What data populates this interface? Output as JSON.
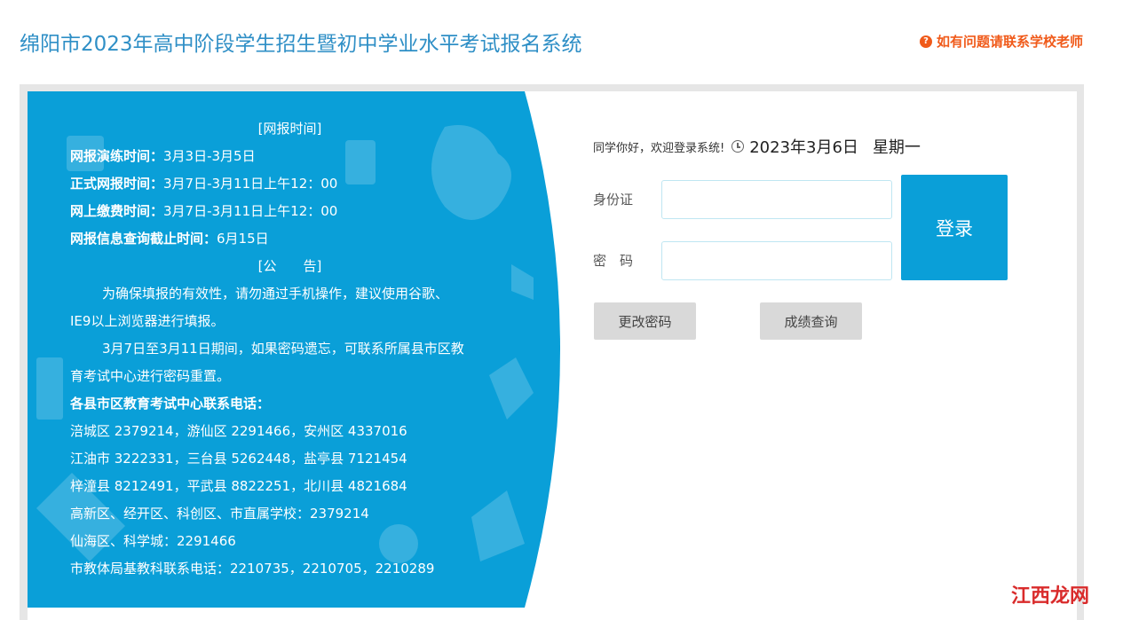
{
  "header": {
    "title": "绵阳市2023年高中阶段学生招生暨初中学业水平考试报名系统",
    "help_text": "如有问题请联系学校老师",
    "help_icon": "question-icon"
  },
  "notice": {
    "heading": "[网报时间]",
    "schedule": [
      {
        "label": "网报演练时间：",
        "value": "3月3日-3月5日"
      },
      {
        "label": "正式网报时间：",
        "value": "3月7日-3月11日上午12：00"
      },
      {
        "label": "网上缴费时间：",
        "value": "3月7日-3月11日上午12：00"
      },
      {
        "label": "网报信息查询截止时间：",
        "value": "6月15日"
      }
    ],
    "announcement_heading": "[公　　告]",
    "paragraph1_line1": "为确保填报的有效性，请勿通过手机操作，建议使用谷歌、",
    "paragraph1_line2": "IE9以上浏览器进行填报。",
    "paragraph2_line1": "3月7日至3月11日期间，如果密码遗忘，可联系所属县市区教",
    "paragraph2_line2": "育考试中心进行密码重置。",
    "phones_heading": "各县市区教育考试中心联系电话：",
    "phones": [
      "涪城区  2379214，游仙区  2291466，安州区  4337016",
      "江油市  3222331，三台县  5262448，盐亭县  7121454",
      "梓潼县  8212491，平武县  8822251，北川县  4821684",
      "高新区、经开区、科创区、市直属学校：2379214",
      "仙海区、科学城：2291466",
      "市教体局基教科联系电话：2210735，2210705，2210289"
    ]
  },
  "login": {
    "welcome": "同学你好，欢迎登录系统!",
    "date": "2023年3月6日",
    "weekday": "星期一",
    "id_label": "身份证",
    "id_value": "",
    "password_label": "密　码",
    "password_value": "",
    "login_button": "登录",
    "change_password_button": "更改密码",
    "score_query_button": "成绩查询"
  },
  "watermark": "江西龙网",
  "colors": {
    "title": "#2f8fc6",
    "help": "#f05a1a",
    "panel_blue": "#0a9fd8",
    "login_button": "#0a9fd8",
    "gray_button": "#d9d9d9"
  }
}
